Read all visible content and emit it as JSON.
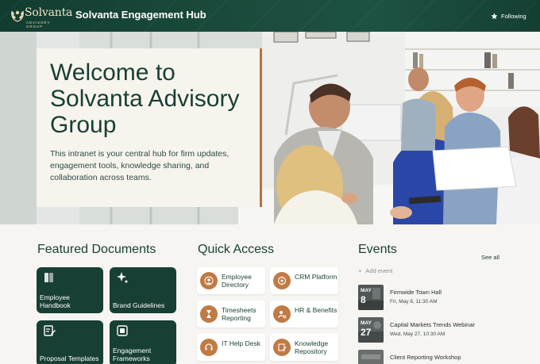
{
  "header": {
    "logo_name": "Solvanta",
    "logo_tagline": "ADVISORY GROUP",
    "site_title": "Solvanta Engagement Hub",
    "follow_label": "Following",
    "colors": {
      "bar": "#173f33",
      "logo_text": "#f1e4c6"
    }
  },
  "hero": {
    "title": "Welcome to Solvanta Advisory Group",
    "body": "This intranet is your central hub for firm updates, engagement tools, knowledge sharing, and collaboration across teams."
  },
  "featured_documents": {
    "title": "Featured Documents",
    "items": [
      {
        "label": "Employee Handbook",
        "icon": "book-icon"
      },
      {
        "label": "Brand Guidelines",
        "icon": "sparkle-icon"
      },
      {
        "label": "Proposal Templates",
        "icon": "edit-document-icon"
      },
      {
        "label": "Engagement Frameworks",
        "icon": "framework-icon"
      }
    ]
  },
  "quick_access": {
    "title": "Quick Access",
    "items": [
      {
        "label": "Employee Directory",
        "icon": "people-icon"
      },
      {
        "label": "CRM Platform",
        "icon": "target-icon"
      },
      {
        "label": "Timesheets Reporting",
        "icon": "hourglass-icon"
      },
      {
        "label": "HR & Benefits",
        "icon": "person-key-icon"
      },
      {
        "label": "IT Help Desk",
        "icon": "headset-icon"
      },
      {
        "label": "Knowledge Repository",
        "icon": "edit-document-icon"
      }
    ]
  },
  "events": {
    "title": "Events",
    "see_all": "See all",
    "add_event": "Add event",
    "items": [
      {
        "month": "MAY",
        "day": "8",
        "title": "Firmwide Town Hall",
        "time": "Fri, May 8, 11:30 AM"
      },
      {
        "month": "MAY",
        "day": "27",
        "title": "Capital Markets Trends Webinar",
        "time": "Wed, May 27, 10:30 AM"
      },
      {
        "month": "",
        "day": "",
        "title": "Client Reporting Workshop",
        "time": ""
      }
    ]
  }
}
